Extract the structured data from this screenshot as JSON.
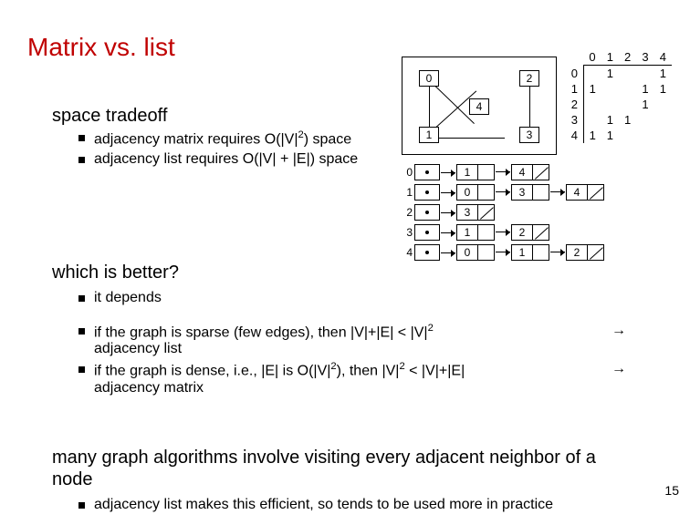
{
  "title": "Matrix vs. list",
  "sections": {
    "spaceTradeoff": {
      "heading": "space tradeoff",
      "bullets": {
        "b1_pre": "adjacency matrix requires O(|V|",
        "b1_sup": "2",
        "b1_post": ") space",
        "b2": "adjacency list requires O(|V| + |E|) space"
      }
    },
    "whichBetter": {
      "heading": "which is better?",
      "bullets": {
        "depends": "it depends",
        "sparse_a": "if the graph is sparse (few edges), then |V|+|E| < |V|",
        "sparse_sup": "2",
        "sparse_arrow": "→",
        "sparse_b": "adjacency list",
        "dense_a": "if the graph is dense, i.e., |E| is O(|V|",
        "dense_sup1": "2",
        "dense_b": "), then |V|",
        "dense_sup2": "2",
        "dense_c": " < |V|+|E|",
        "dense_arrow": "→",
        "dense_d": "adjacency matrix"
      }
    },
    "many": {
      "heading": "many graph algorithms involve visiting every adjacent neighbor of a node",
      "bullet": "adjacency list makes this efficient, so tends to be used more in practice"
    }
  },
  "graph": {
    "nodes": [
      "0",
      "2",
      "4",
      "1",
      "3"
    ]
  },
  "matrix": {
    "headers": [
      "0",
      "1",
      "2",
      "3",
      "4"
    ],
    "rows": [
      {
        "idx": "0",
        "cells": [
          "",
          "1",
          "",
          "",
          "1"
        ]
      },
      {
        "idx": "1",
        "cells": [
          "1",
          "",
          "",
          "1",
          "1"
        ]
      },
      {
        "idx": "2",
        "cells": [
          "",
          "",
          "",
          "1",
          ""
        ]
      },
      {
        "idx": "3",
        "cells": [
          "",
          "1",
          "1",
          "",
          ""
        ]
      },
      {
        "idx": "4",
        "cells": [
          "1",
          "1",
          "",
          "",
          ""
        ]
      }
    ]
  },
  "adjlist": [
    {
      "idx": "0",
      "nodes": [
        "1",
        "4"
      ]
    },
    {
      "idx": "1",
      "nodes": [
        "0",
        "3",
        "4"
      ]
    },
    {
      "idx": "2",
      "nodes": [
        "3"
      ]
    },
    {
      "idx": "3",
      "nodes": [
        "1",
        "2"
      ]
    },
    {
      "idx": "4",
      "nodes": [
        "0",
        "1",
        "2"
      ]
    }
  ],
  "pageNumber": "15"
}
